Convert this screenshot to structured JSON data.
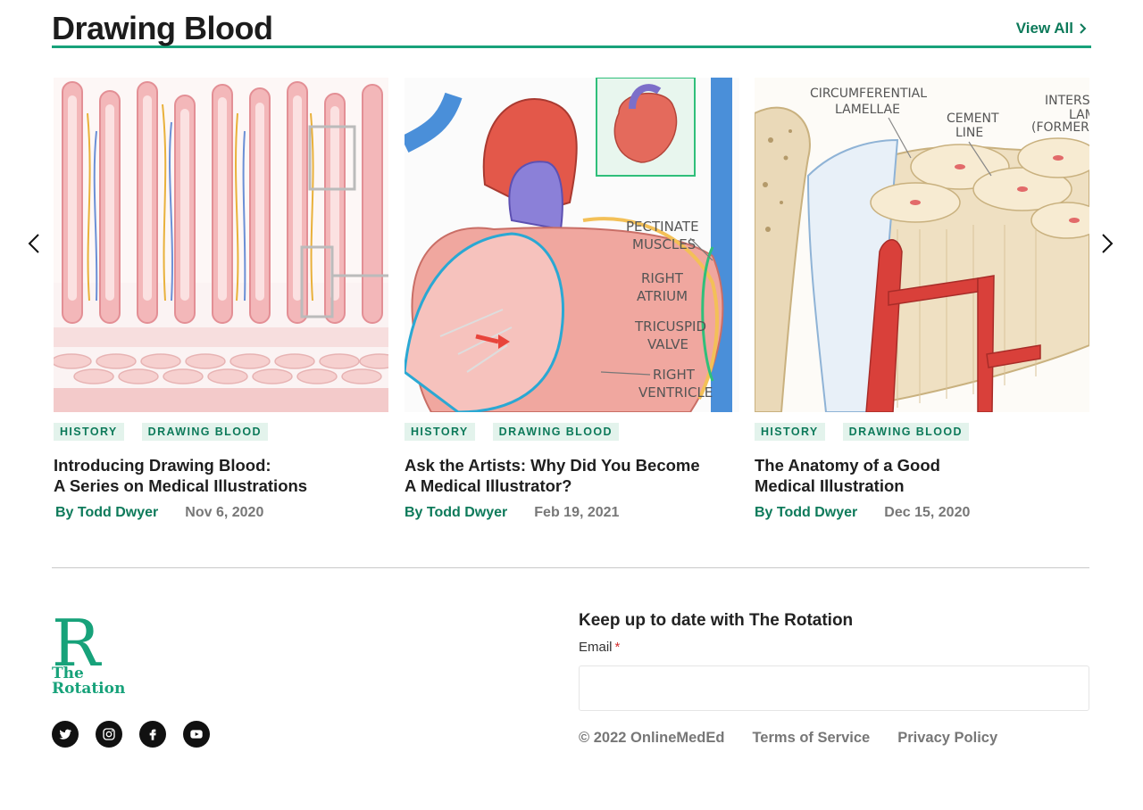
{
  "section": {
    "title": "Drawing Blood",
    "view_all": "View All"
  },
  "carousel": {
    "prev_icon": "chevron-left-icon",
    "next_icon": "chevron-right-icon",
    "cards": [
      {
        "tags": [
          "HISTORY",
          "DRAWING BLOOD"
        ],
        "title_line1": "Introducing Drawing Blood:",
        "title_line2": "A Series on Medical Illustrations",
        "author": "By Todd Dwyer",
        "date": "Nov 6, 2020"
      },
      {
        "tags": [
          "HISTORY",
          "DRAWING BLOOD"
        ],
        "title_line1": "Ask the Artists: Why Did You Become",
        "title_line2": "A Medical Illustrator?",
        "author": "By Todd Dwyer",
        "date": "Feb 19, 2021",
        "image_labels": [
          "PECTINATE",
          "MUSCLES",
          "RIGHT",
          "ATRIUM",
          "TRICUSPID",
          "VALVE",
          "RIGHT",
          "VENTRICLE"
        ]
      },
      {
        "tags": [
          "HISTORY",
          "DRAWING BLOOD"
        ],
        "title_line1": "The Anatomy of a Good",
        "title_line2": "Medical Illustration",
        "author": "By Todd Dwyer",
        "date": "Dec 15, 2020",
        "image_labels": [
          "CIRCUMFERENTIAL",
          "LAMELLAE",
          "CEMENT",
          "LINE",
          "INTERS",
          "LAME",
          "(FORMER"
        ]
      }
    ]
  },
  "footer": {
    "logo_text": [
      "R",
      "The",
      "Rotation"
    ],
    "brand_color": "#17a27a",
    "social": [
      "twitter-icon",
      "instagram-icon",
      "facebook-icon",
      "youtube-icon"
    ],
    "newsletter_title": "Keep up to date with The Rotation",
    "email_label": "Email",
    "email_required": "*",
    "email_value": "",
    "copyright": "© 2022 OnlineMedEd",
    "terms": "Terms of Service",
    "privacy": "Privacy Policy"
  }
}
